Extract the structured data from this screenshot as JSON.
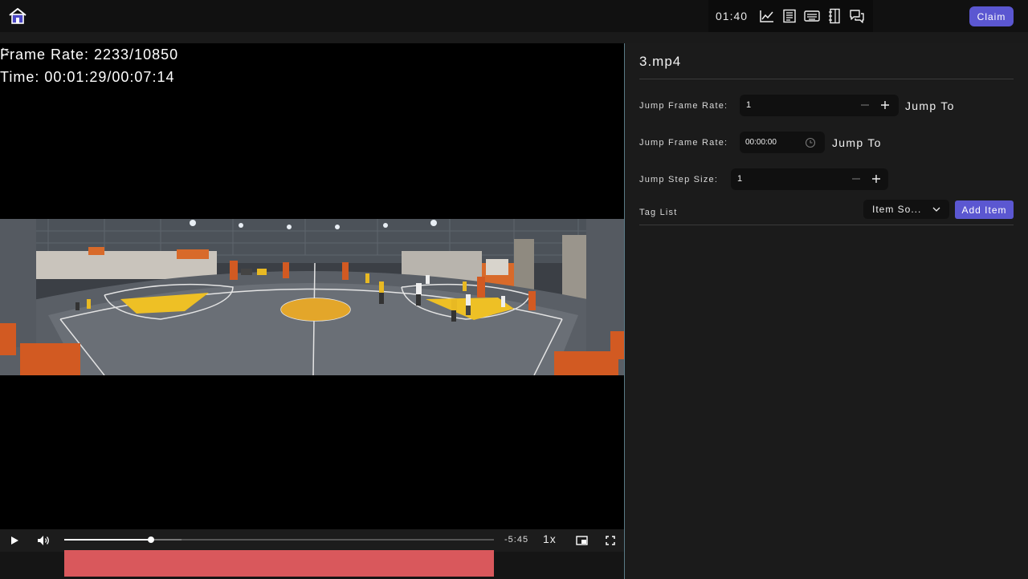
{
  "header": {
    "home_icon": "home-icon",
    "timer": "01:40",
    "tools": [
      "chart-line-icon",
      "document-icon",
      "keyboard-icon",
      "notebook-icon",
      "chat-icon"
    ],
    "claim_label": "Claim",
    "accent_color": "#5b57d1"
  },
  "video": {
    "frame_rate_line": "Frame Rate: 2233/10850",
    "time_line": "Time: 00:01:29/00:07:14",
    "scene": "indoor basketball court",
    "controls": {
      "play_icon": "play-icon",
      "volume_icon": "volume-icon",
      "progress": 0.202,
      "buffered": 0.272,
      "remaining": "-5:45",
      "speed": "1x",
      "pip_icon": "picture-in-picture-icon",
      "fullscreen_icon": "fullscreen-icon"
    },
    "tag_bar_color": "#d9585c"
  },
  "panel": {
    "file_name": "3.mp4",
    "jump_frame": {
      "label": "Jump Frame Rate:",
      "value": "1",
      "action": "Jump To"
    },
    "jump_time": {
      "label": "Jump Frame Rate:",
      "value": "00:00:00",
      "action": "Jump To"
    },
    "step_size": {
      "label": "Jump Step Size:",
      "value": "1"
    },
    "tag_list": {
      "label": "Tag List",
      "sort_value": "Item So...",
      "add_label": "Add Item"
    }
  }
}
